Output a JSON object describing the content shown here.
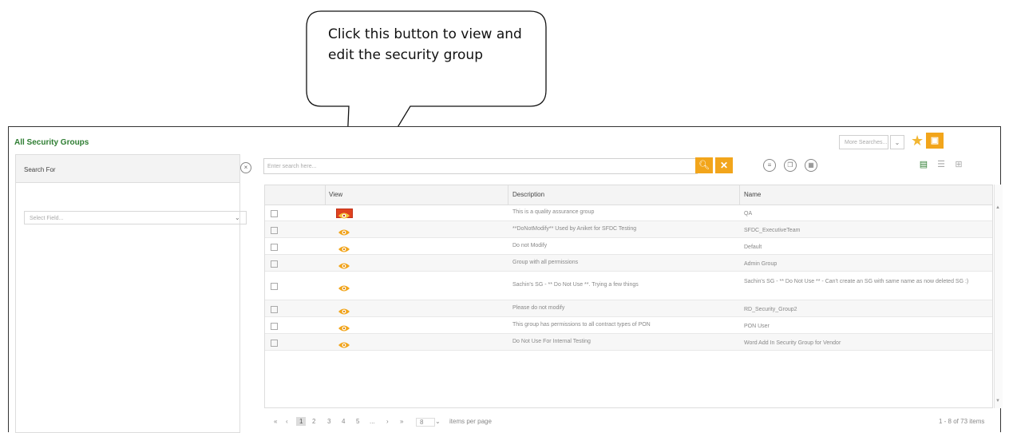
{
  "callout": {
    "text": "Click this button to view and edit the security group"
  },
  "header": {
    "title": "All Security Groups",
    "more_searches_placeholder": "More Searches...",
    "star_icon": "star-icon",
    "save_icon": "save-icon"
  },
  "left_panel": {
    "search_for": "Search For",
    "select_field_placeholder": "Select Field..."
  },
  "search": {
    "placeholder": "Enter search here..."
  },
  "grid": {
    "columns": [
      "View",
      "Description",
      "Name"
    ],
    "rows": [
      {
        "description": "This is a quality assurance group",
        "name": "QA"
      },
      {
        "description": "**DoNotModify** Used by Aniket for SFDC Testing",
        "name": "SFDC_ExecutiveTeam"
      },
      {
        "description": "Do not Modify",
        "name": "Default"
      },
      {
        "description": "Group with all permissions",
        "name": "Admin Group"
      },
      {
        "description": "Sachin's SG - ** Do Not Use **. Trying a few things",
        "name": "Sachin's SG - ** Do Not Use ** - Can't create an SG with same name as now deleted SG :)"
      },
      {
        "description": "Please do not modify",
        "name": "RD_Security_Group2"
      },
      {
        "description": "This group has permissions to all contract types of PON",
        "name": "PON User"
      },
      {
        "description": "Do Not Use For Internal Testing",
        "name": "Word Add In Security Group for Vendor"
      }
    ]
  },
  "pager": {
    "pages": [
      "1",
      "2",
      "3",
      "4",
      "5",
      "..."
    ],
    "page_size": "8",
    "items_per_page": "items per page",
    "summary": "1 - 8 of 73 items"
  },
  "colors": {
    "accent": "#f2a51b",
    "highlight": "#e0431f",
    "title_green": "#2e7d32"
  }
}
